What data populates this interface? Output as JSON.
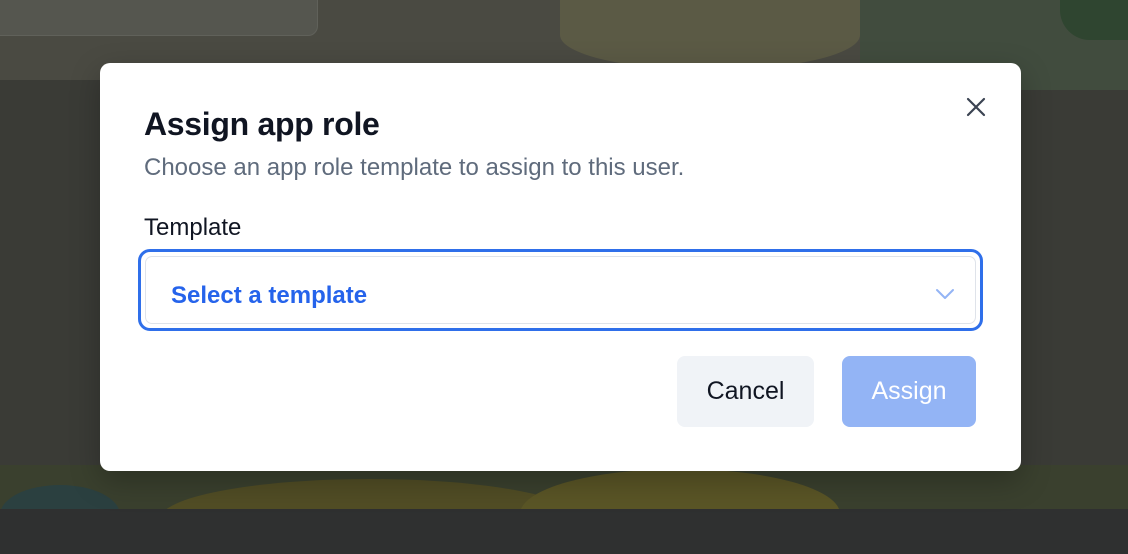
{
  "dialog": {
    "title": "Assign app role",
    "subtitle": "Choose an app role template to assign to this user.",
    "close_icon": "close-icon"
  },
  "template_field": {
    "label": "Template",
    "placeholder": "Select a template",
    "chevron_icon": "chevron-down-icon"
  },
  "actions": {
    "cancel_label": "Cancel",
    "assign_label": "Assign",
    "assign_disabled": true
  },
  "colors": {
    "accent": "#2563eb",
    "focus_border": "#2f6fea",
    "assign_disabled_bg": "#93b4f5",
    "cancel_bg": "#f0f3f7",
    "title_text": "#101522",
    "subtitle_text": "#5f6b7c"
  }
}
